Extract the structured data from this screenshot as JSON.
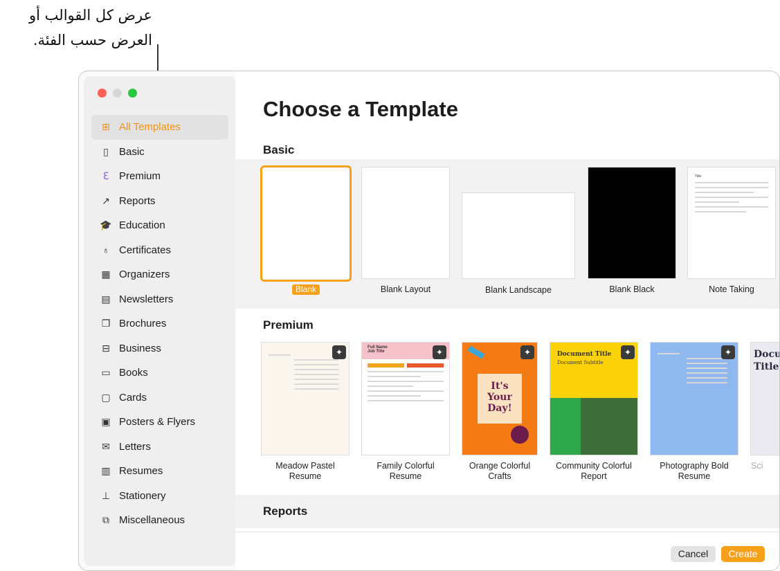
{
  "callout": {
    "line1": "عرض كل القوالب أو",
    "line2": "العرض حسب الفئة."
  },
  "sidebar": {
    "items": [
      {
        "label": "All Templates",
        "icon": "grid-icon",
        "glyph": "⊞",
        "active": true
      },
      {
        "label": "Basic",
        "icon": "document-icon",
        "glyph": "▯"
      },
      {
        "label": "Premium",
        "icon": "premium-icon",
        "glyph": "ℇ"
      },
      {
        "label": "Reports",
        "icon": "trend-icon",
        "glyph": "↗"
      },
      {
        "label": "Education",
        "icon": "graduation-cap-icon",
        "glyph": "🎓"
      },
      {
        "label": "Certificates",
        "icon": "ribbon-icon",
        "glyph": "♁"
      },
      {
        "label": "Organizers",
        "icon": "organizer-icon",
        "glyph": "▦"
      },
      {
        "label": "Newsletters",
        "icon": "newsletter-icon",
        "glyph": "▤"
      },
      {
        "label": "Brochures",
        "icon": "brochure-icon",
        "glyph": "❐"
      },
      {
        "label": "Business",
        "icon": "briefcase-icon",
        "glyph": "⊟"
      },
      {
        "label": "Books",
        "icon": "book-icon",
        "glyph": "▭"
      },
      {
        "label": "Cards",
        "icon": "card-icon",
        "glyph": "▢"
      },
      {
        "label": "Posters & Flyers",
        "icon": "poster-icon",
        "glyph": "▣"
      },
      {
        "label": "Letters",
        "icon": "letter-icon",
        "glyph": "✉"
      },
      {
        "label": "Resumes",
        "icon": "resume-icon",
        "glyph": "▥"
      },
      {
        "label": "Stationery",
        "icon": "stamp-icon",
        "glyph": "⊥"
      },
      {
        "label": "Miscellaneous",
        "icon": "misc-icon",
        "glyph": "⧉"
      }
    ]
  },
  "main": {
    "title": "Choose a Template",
    "sections": {
      "basic": "Basic",
      "premium": "Premium",
      "reports": "Reports"
    },
    "basic_templates": [
      "Blank",
      "Blank Layout",
      "Blank Landscape",
      "Blank Black",
      "Note Taking"
    ],
    "premium_templates": [
      [
        "Meadow Pastel",
        "Resume"
      ],
      [
        "Family Colorful",
        "Resume"
      ],
      [
        "Orange Colorful",
        "Crafts"
      ],
      [
        "Community Colorful",
        "Report"
      ],
      [
        "Photography Bold",
        "Resume"
      ],
      [
        "Sci",
        ""
      ]
    ],
    "thumb_text": {
      "family_name": "Full Name",
      "family_title": "Job Title",
      "orange_line1": "It's",
      "orange_line2": "Your",
      "orange_line3": "Day!",
      "community_title": "Document Title",
      "community_subtitle": "Document Subtitle",
      "sci_title1": "Docu",
      "sci_title2": "Title",
      "note_title": "Title"
    }
  },
  "footer": {
    "cancel": "Cancel",
    "create": "Create"
  },
  "colors": {
    "accent": "#f7a11a",
    "selection_text": "#f0920d",
    "premium_icon": "#8a5cd6"
  }
}
